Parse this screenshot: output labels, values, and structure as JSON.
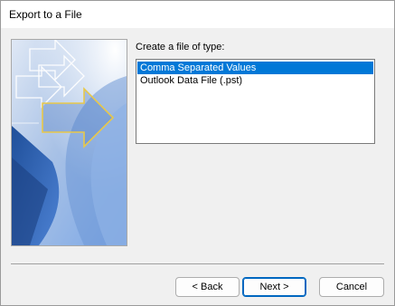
{
  "window": {
    "title": "Export to a File"
  },
  "main": {
    "prompt_label": "Create a file of type:",
    "file_types": [
      {
        "label": "Comma Separated Values",
        "selected": true
      },
      {
        "label": "Outlook Data File (.pst)",
        "selected": false
      }
    ]
  },
  "buttons": {
    "back_label": "< Back",
    "next_label": "Next >",
    "cancel_label": "Cancel"
  },
  "colors": {
    "selection": "#0078d7",
    "banner_blue": "#2d5fa8",
    "arrow_gold": "#e8c84a"
  }
}
